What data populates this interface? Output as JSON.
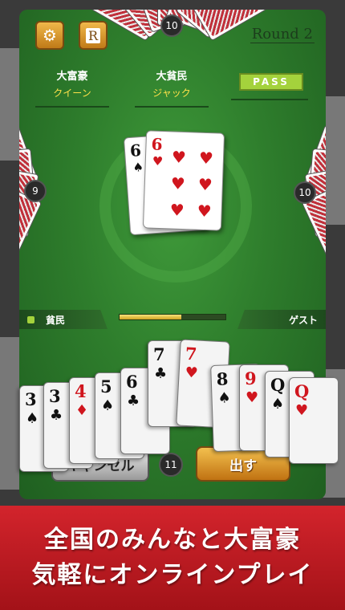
{
  "top_bar": {
    "settings_icon": "gear-icon",
    "rules_icon": "rules-card-icon",
    "rules_glyph": "R",
    "top_opponent_count": "10",
    "round_label": "Round 2"
  },
  "ranks": [
    {
      "title": "大富豪",
      "card": "クイーン"
    },
    {
      "title": "大貧民",
      "card": "ジャック"
    }
  ],
  "pass_label": "PASS",
  "opponents": {
    "left_count": "9",
    "right_count": "10"
  },
  "table_pile": {
    "card": {
      "rank": "6",
      "suit": "♠",
      "color": "black"
    },
    "top_card": {
      "rank": "6",
      "suit": "♥",
      "color": "red",
      "pips": [
        "♥",
        "♥",
        "♥",
        "♥",
        "♥",
        "♥"
      ]
    }
  },
  "player_info": {
    "rank_label": "貧民",
    "opponent_label": "ゲスト",
    "timer_progress": 0.58
  },
  "hand": [
    {
      "rank": "3",
      "suit": "♠",
      "color": "black"
    },
    {
      "rank": "3",
      "suit": "♣",
      "color": "black"
    },
    {
      "rank": "4",
      "suit": "♦",
      "color": "red"
    },
    {
      "rank": "5",
      "suit": "♠",
      "color": "black"
    },
    {
      "rank": "6",
      "suit": "♣",
      "color": "black"
    },
    {
      "rank": "7",
      "suit": "♣",
      "color": "black"
    },
    {
      "rank": "7",
      "suit": "♥",
      "color": "red"
    },
    {
      "rank": "8",
      "suit": "♠",
      "color": "black"
    },
    {
      "rank": "9",
      "suit": "♥",
      "color": "red"
    },
    {
      "rank": "Q",
      "suit": "♠",
      "color": "black"
    },
    {
      "rank": "Q",
      "suit": "♥",
      "color": "red"
    }
  ],
  "actions": {
    "cancel_label": "キャンセル",
    "hand_count": "11",
    "play_label": "出す"
  },
  "banner": {
    "line1": "全国のみんなと大富豪",
    "line2": "気軽にオンラインプレイ"
  },
  "colors": {
    "felt": "#2e7d2c",
    "accent_gold": "#e0a22a",
    "banner_red": "#c01a22",
    "pass_green": "#a4d23c"
  }
}
